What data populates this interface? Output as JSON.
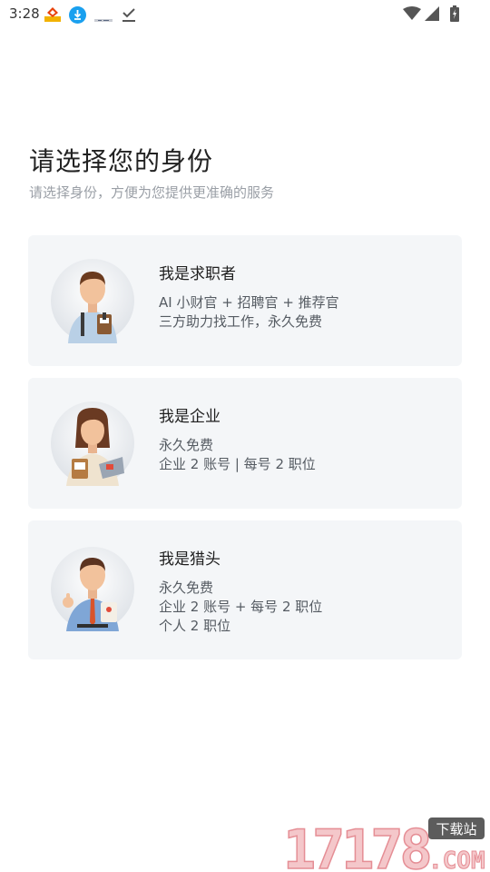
{
  "status_bar": {
    "time": "3:28",
    "icons": [
      "app-badge-icon",
      "download-icon",
      "notification-icon",
      "check-icon",
      "wifi-icon",
      "signal-icon",
      "battery-icon"
    ]
  },
  "header": {
    "title": "请选择您的身份",
    "subtitle": "请选择身份，方便为您提供更准确的服务"
  },
  "roles": [
    {
      "title": "我是求职者",
      "lines": [
        "AI 小财官 + 招聘官 + 推荐官",
        "三方助力找工作，永久免费"
      ],
      "avatar": "job-seeker-avatar"
    },
    {
      "title": "我是企业",
      "lines": [
        "永久免费",
        "企业 2 账号 | 每号 2 职位"
      ],
      "avatar": "enterprise-avatar"
    },
    {
      "title": "我是猎头",
      "lines": [
        "永久免费",
        "企业 2 账号 + 每号 2 职位",
        "个人 2 职位"
      ],
      "avatar": "headhunter-avatar"
    }
  ],
  "watermark": {
    "number": "17178",
    "tag": "下载站",
    "domain": ".COM"
  },
  "colors": {
    "card_bg": "#f4f6f8",
    "subtitle": "#9a9fa6",
    "body_text": "#555b62",
    "watermark": "#f0a8ad"
  }
}
